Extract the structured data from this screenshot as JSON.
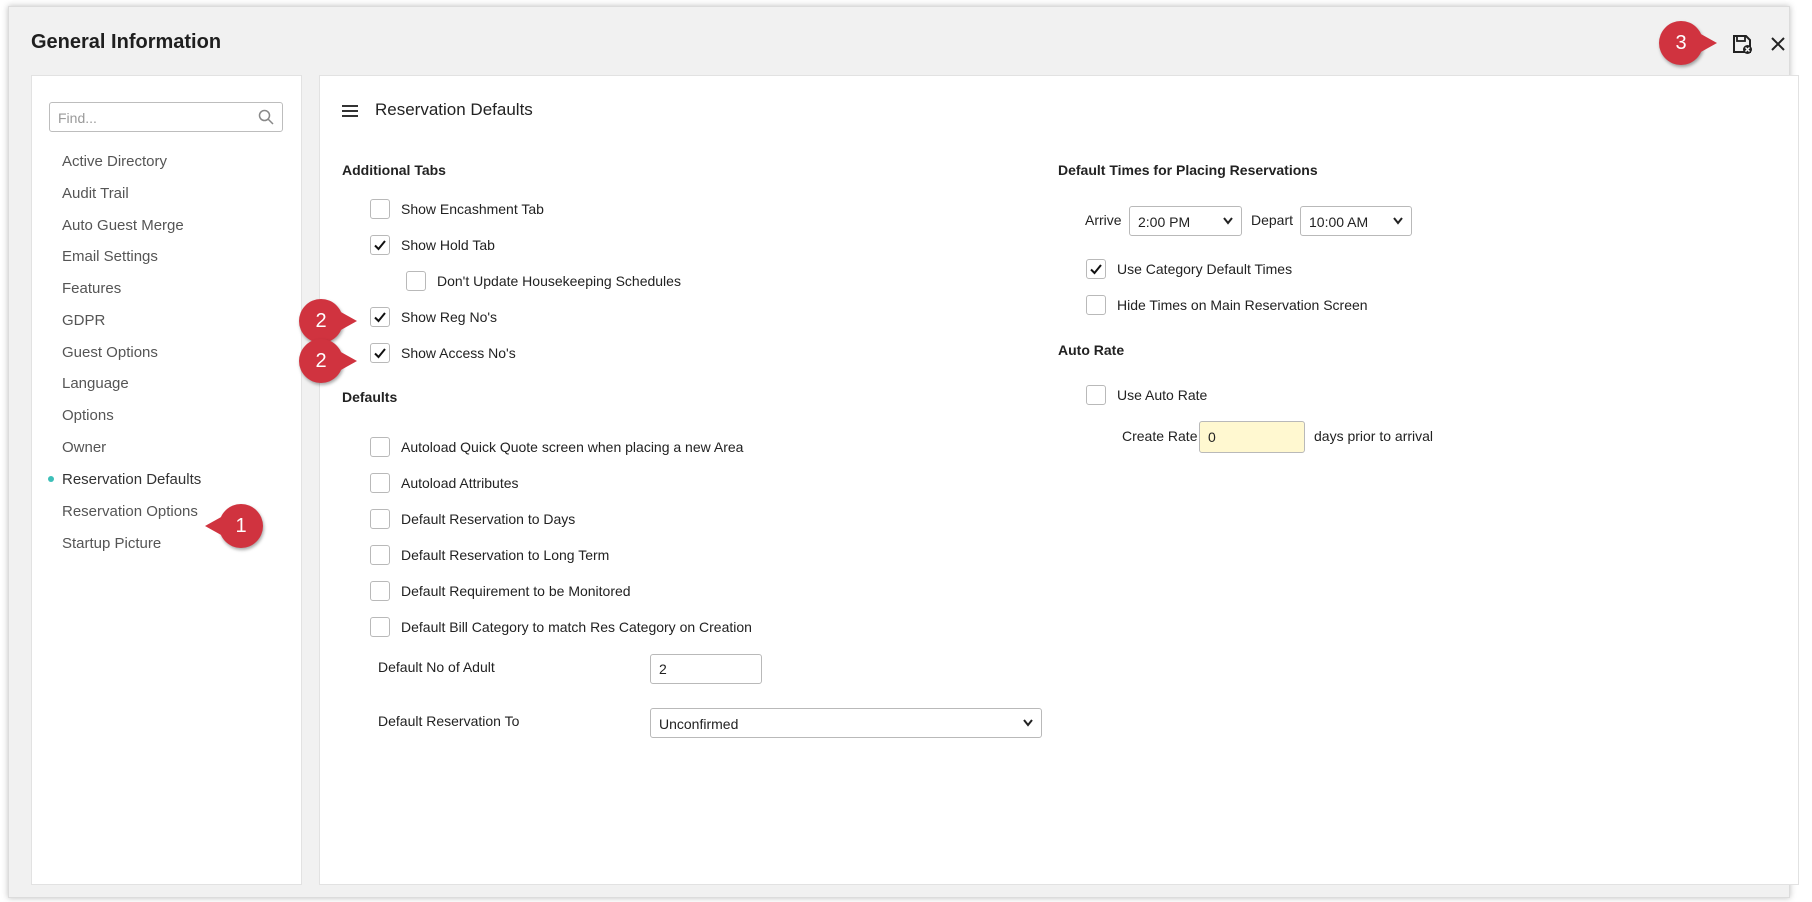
{
  "window": {
    "title": "General Information"
  },
  "sidebar": {
    "search_placeholder": "Find...",
    "items": [
      {
        "label": "Active Directory"
      },
      {
        "label": "Audit Trail"
      },
      {
        "label": "Auto Guest Merge"
      },
      {
        "label": "Email Settings"
      },
      {
        "label": "Features"
      },
      {
        "label": "GDPR"
      },
      {
        "label": "Guest Options"
      },
      {
        "label": "Language"
      },
      {
        "label": "Options"
      },
      {
        "label": "Owner"
      },
      {
        "label": "Reservation Defaults",
        "active": true
      },
      {
        "label": "Reservation Options"
      },
      {
        "label": "Startup Picture"
      }
    ]
  },
  "panel": {
    "title": "Reservation Defaults",
    "additional_tabs": {
      "heading": "Additional Tabs",
      "items": [
        {
          "label": "Show Encashment Tab",
          "checked": false
        },
        {
          "label": "Show Hold Tab",
          "checked": true
        },
        {
          "label": "Don't Update Housekeeping Schedules",
          "checked": false
        },
        {
          "label": "Show Reg No's",
          "checked": true
        },
        {
          "label": "Show Access No's",
          "checked": true
        }
      ]
    },
    "defaults": {
      "heading": "Defaults",
      "items": [
        {
          "label": "Autoload Quick Quote screen when placing a new Area",
          "checked": false
        },
        {
          "label": "Autoload Attributes",
          "checked": false
        },
        {
          "label": "Default Reservation to Days",
          "checked": false
        },
        {
          "label": "Default Reservation to Long Term",
          "checked": false
        },
        {
          "label": "Default Requirement to be Monitored",
          "checked": false
        },
        {
          "label": "Default Bill Category to match Res Category on Creation",
          "checked": false
        }
      ],
      "adults_label": "Default No of Adult",
      "adults_value": "2",
      "reservation_to_label": "Default Reservation To",
      "reservation_to_value": "Unconfirmed"
    },
    "default_times": {
      "heading": "Default Times for Placing Reservations",
      "arrive_label": "Arrive",
      "arrive_value": "2:00 PM",
      "depart_label": "Depart",
      "depart_value": "10:00 AM",
      "items": [
        {
          "label": "Use Category Default Times",
          "checked": true
        },
        {
          "label": "Hide Times on Main Reservation Screen",
          "checked": false
        }
      ]
    },
    "auto_rate": {
      "heading": "Auto Rate",
      "use_label": "Use Auto Rate",
      "use_checked": false,
      "create_rate_label": "Create Rate",
      "create_rate_value": "0",
      "create_rate_suffix": "days prior to arrival"
    }
  },
  "annotations": [
    {
      "number": "1"
    },
    {
      "number": "2"
    },
    {
      "number": "2"
    },
    {
      "number": "3"
    }
  ],
  "colors": {
    "badge": "#d0333f",
    "active_dot": "#3dbfb8",
    "create_rate_bg": "#fff8d0"
  },
  "icons": [
    "save-icon",
    "close-icon",
    "search-icon",
    "hamburger-menu-icon",
    "checkmark-icon",
    "chevron-down-icon"
  ]
}
